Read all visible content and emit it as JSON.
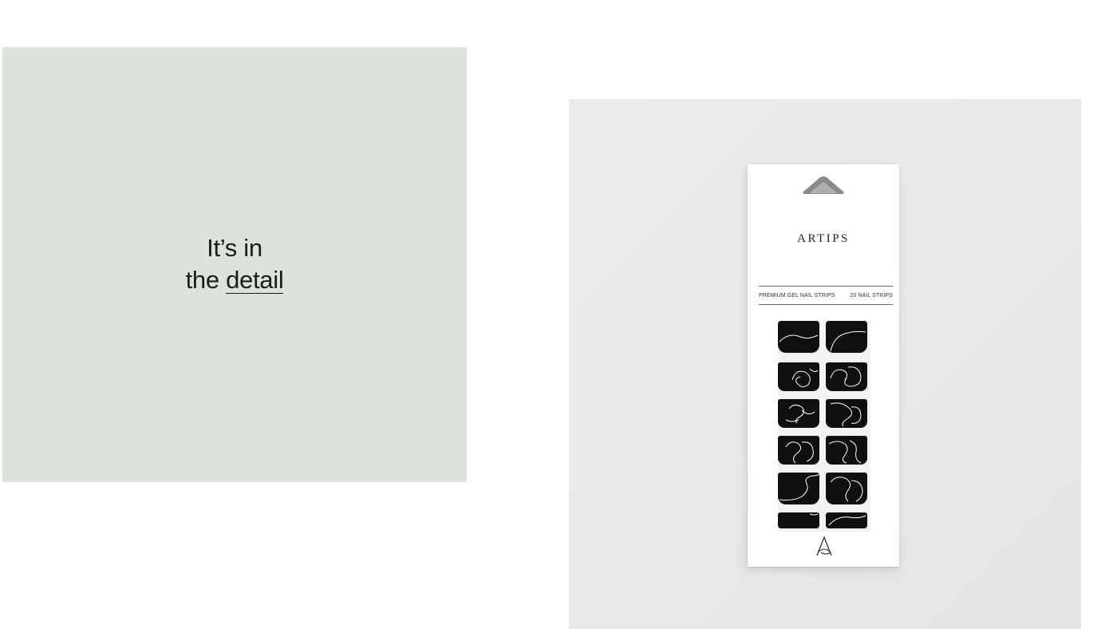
{
  "left_panel": {
    "headline_line1": "It’s in",
    "headline_line2_prefix": "the ",
    "headline_line2_emphasis": "detail",
    "background": "#dce3da"
  },
  "product": {
    "brand": "ARTIPS",
    "label_left": "PREMIUM GEL NAIL STRIPS",
    "label_right": "20 NAIL STRIPS",
    "strip_color": "#0f0f0f",
    "line_art_color": "#ffffff",
    "icons": [
      "hang-hole-icon",
      "artips-logo-icon"
    ]
  }
}
